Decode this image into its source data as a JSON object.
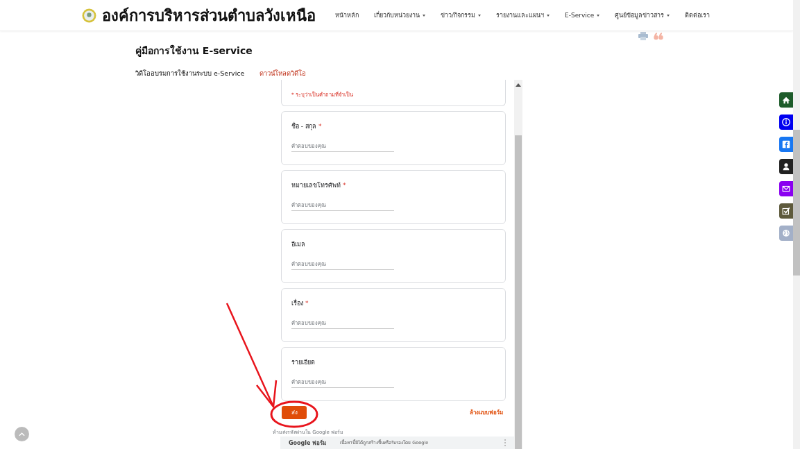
{
  "site": {
    "title": "องค์การบริหารส่วนตำบลวังเหนือ",
    "nav": [
      {
        "label": "หน้าหลัก",
        "dropdown": false
      },
      {
        "label": "เกี่ยวกับหน่วยงาน",
        "dropdown": true
      },
      {
        "label": "ข่าว/กิจกรรม",
        "dropdown": true
      },
      {
        "label": "รายงานและแผนฯ",
        "dropdown": true
      },
      {
        "label": "E-Service",
        "dropdown": true
      },
      {
        "label": "ศูนย์ข้อมูลข่าวสาร",
        "dropdown": true
      },
      {
        "label": "ติดต่อเรา",
        "dropdown": false
      }
    ]
  },
  "page": {
    "heading": "คู่มือการใช้งาน E-service",
    "tabs": [
      {
        "label": "วิดีโออบรมการใช้งานระบบ e-Service",
        "selected": true
      },
      {
        "label": "ดาวน์โหลดวิดีโอ",
        "selected": false
      }
    ]
  },
  "form": {
    "required_note": "* ระบุว่าเป็นคำถามที่จำเป็น",
    "required_mark": "*",
    "questions": [
      {
        "label": "ชื่อ - สกุล",
        "required": true,
        "placeholder": "คำตอบของคุณ"
      },
      {
        "label": "หมายเลขโทรศัพท์",
        "required": true,
        "placeholder": "คำตอบของคุณ"
      },
      {
        "label": "อีเมล",
        "required": false,
        "placeholder": "คำตอบของคุณ"
      },
      {
        "label": "เรื่อง",
        "required": true,
        "placeholder": "คำตอบของคุณ"
      },
      {
        "label": "รายเอียด",
        "required": false,
        "placeholder": "คำตอบของคุณ"
      }
    ],
    "submit": "ส่ง",
    "clear": "ล้างแบบฟอร์ม",
    "warning": "ห้ามส่งรหัสผ่านใน Google ฟอร์ม",
    "footer": {
      "brand": "Google ฟอร์ม",
      "disclaimer": "เนื้อหานี้มิได้ถูกสร้างขึ้นหรือรับรองโดย Google"
    }
  },
  "side_buttons": [
    {
      "kind": "home",
      "color": "#1e5c2b"
    },
    {
      "kind": "info",
      "color": "#0000f0"
    },
    {
      "kind": "facebook",
      "color": "#1877f2"
    },
    {
      "kind": "user",
      "color": "#222222"
    },
    {
      "kind": "mail",
      "color": "#8a00f0"
    },
    {
      "kind": "check",
      "color": "#5e5a3c"
    },
    {
      "kind": "globe",
      "color": "#a3b0c8"
    }
  ]
}
